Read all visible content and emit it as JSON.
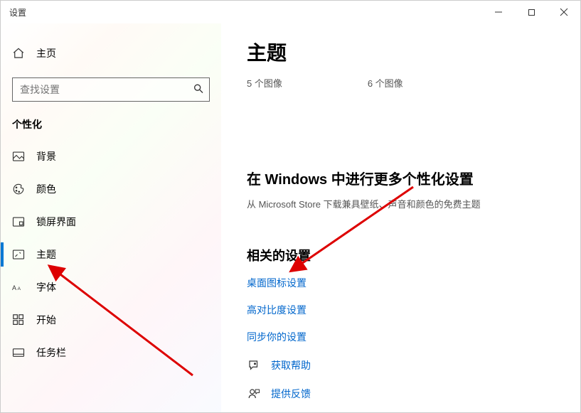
{
  "window": {
    "title": "设置"
  },
  "sidebar": {
    "home_label": "主页",
    "search_placeholder": "查找设置",
    "section_title": "个性化",
    "items": [
      {
        "label": "背景"
      },
      {
        "label": "颜色"
      },
      {
        "label": "锁屏界面"
      },
      {
        "label": "主题"
      },
      {
        "label": "字体"
      },
      {
        "label": "开始"
      },
      {
        "label": "任务栏"
      }
    ]
  },
  "content": {
    "page_title": "主题",
    "thumb_count_1": "5 个图像",
    "thumb_count_2": "6 个图像",
    "more_heading": "在 Windows 中进行更多个性化设置",
    "more_desc": "从 Microsoft Store 下载兼具壁纸、声音和颜色的免费主题",
    "related_heading": "相关的设置",
    "links": [
      {
        "label": "桌面图标设置"
      },
      {
        "label": "高对比度设置"
      },
      {
        "label": "同步你的设置"
      }
    ],
    "help": {
      "label": "获取帮助"
    },
    "feedback": {
      "label": "提供反馈"
    }
  }
}
